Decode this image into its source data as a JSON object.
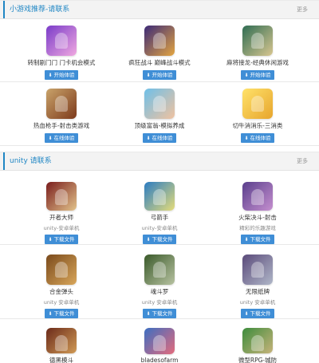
{
  "section1": {
    "title": "小游戏推荐-请联系",
    "more": "更多",
    "items": [
      {
        "name": "转制剧门门 门卡机会模式",
        "button": "开始体验",
        "icon": "game-thumb-icon",
        "colors": [
          "#7a3cc9",
          "#f0a8e0"
        ]
      },
      {
        "name": "疯狂战斗 巅峰战斗模式",
        "button": "开始体验",
        "icon": "game-thumb-icon",
        "colors": [
          "#3c2a78",
          "#e3a541"
        ]
      },
      {
        "name": "麻将接龙-经典休闲游戏",
        "button": "开始体验",
        "icon": "game-thumb-icon",
        "colors": [
          "#2f6d53",
          "#d8c690"
        ]
      },
      {
        "name": "热血枪手-射击类游戏",
        "button": "在线体验",
        "icon": "game-thumb-icon",
        "colors": [
          "#c9a36a",
          "#7d3a1c"
        ]
      },
      {
        "name": "顶级富翁-模拟养成",
        "button": "在线体验",
        "icon": "game-thumb-icon",
        "colors": [
          "#6fc0e8",
          "#f0c2a0"
        ]
      },
      {
        "name": "切牛消消乐-三消类",
        "button": "在线体验",
        "icon": "game-thumb-icon",
        "colors": [
          "#ffe26a",
          "#e7a52d"
        ]
      }
    ]
  },
  "section2": {
    "title": "unity 请联系",
    "more": "更多",
    "items": [
      {
        "name": "开者大师",
        "sub": "unity-安卓单机",
        "button": "下载文件",
        "icon": "game-thumb-icon",
        "colors": [
          "#7a1d1d",
          "#e2c38b"
        ]
      },
      {
        "name": "弓箭手",
        "sub": "unity-安卓单机",
        "button": "下载文件",
        "icon": "game-thumb-icon",
        "colors": [
          "#2b7cc2",
          "#e5dc7a"
        ]
      },
      {
        "name": "火柴决斗-射击",
        "sub": "精彩的乐趣游戏",
        "button": "下载文件",
        "icon": "game-thumb-icon",
        "colors": [
          "#5a3f8c",
          "#c58fcf"
        ]
      },
      {
        "name": "合金弹头",
        "sub": "unity 安卓单机",
        "button": "下载文件",
        "icon": "game-thumb-icon",
        "colors": [
          "#7a4a1c",
          "#d8a65a"
        ]
      },
      {
        "name": "魂斗罗",
        "sub": "unity 安卓单机",
        "button": "下载文件",
        "icon": "game-thumb-icon",
        "colors": [
          "#3a5a2a",
          "#b7c2a1"
        ]
      },
      {
        "name": "无限纸牌",
        "sub": "unity 安卓单机",
        "button": "下载文件",
        "icon": "game-thumb-icon",
        "colors": [
          "#5a4a7a",
          "#b0b7c8"
        ]
      },
      {
        "name": "德黑模斗",
        "button": "",
        "icon": "game-thumb-icon",
        "colors": [
          "#6b2a1a",
          "#d09a55"
        ]
      },
      {
        "name": "bladesofarm",
        "button": "",
        "icon": "game-thumb-icon",
        "colors": [
          "#3c6ec2",
          "#e46b7c"
        ]
      },
      {
        "name": "微型RPG-城防",
        "button": "",
        "icon": "game-thumb-icon",
        "colors": [
          "#3c8c3c",
          "#c7b37a"
        ]
      }
    ]
  }
}
